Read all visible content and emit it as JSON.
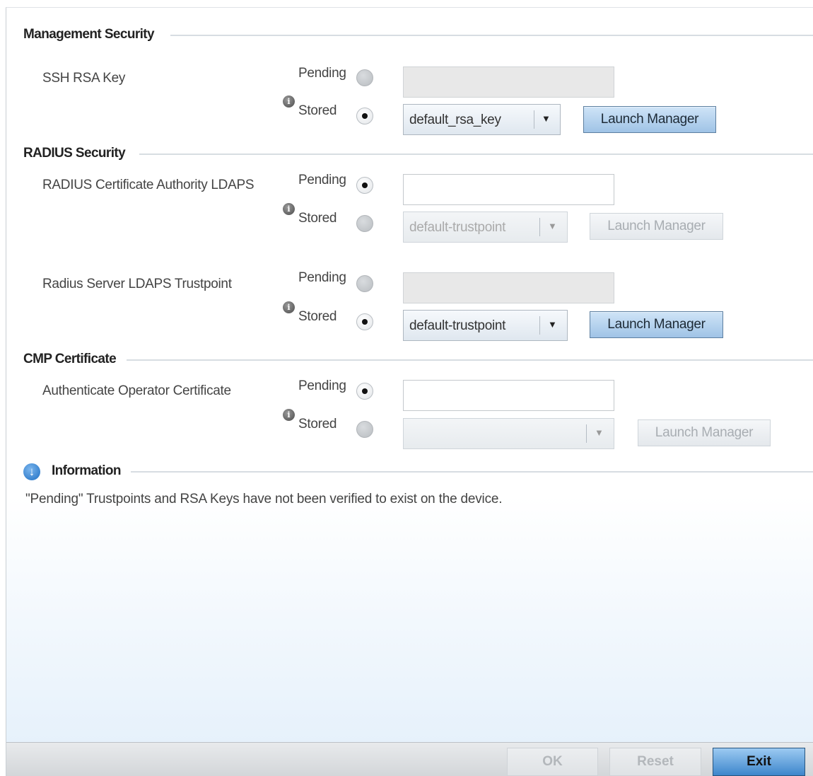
{
  "sections": {
    "management": {
      "title": "Management Security",
      "ssh_rsa_key": {
        "label": "SSH RSA Key",
        "pending_label": "Pending",
        "stored_label": "Stored",
        "selected": "stored",
        "pending_value": "",
        "stored_value": "default_rsa_key",
        "launch_label": "Launch Manager"
      }
    },
    "radius": {
      "title": "RADIUS Security",
      "ca_ldaps": {
        "label": "RADIUS Certificate Authority LDAPS",
        "pending_label": "Pending",
        "stored_label": "Stored",
        "selected": "pending",
        "pending_value": "",
        "stored_value": "default-trustpoint",
        "launch_label": "Launch Manager"
      },
      "server_ldaps": {
        "label": "Radius Server LDAPS Trustpoint",
        "pending_label": "Pending",
        "stored_label": "Stored",
        "selected": "stored",
        "pending_value": "",
        "stored_value": "default-trustpoint",
        "launch_label": "Launch Manager"
      }
    },
    "cmp": {
      "title": "CMP Certificate",
      "operator_cert": {
        "label": "Authenticate Operator Certificate",
        "pending_label": "Pending",
        "stored_label": "Stored",
        "selected": "pending",
        "pending_value": "",
        "stored_value": "",
        "launch_label": "Launch Manager"
      }
    },
    "information": {
      "title": "Information",
      "text": "\"Pending\" Trustpoints and RSA Keys have not been verified to exist on the device."
    }
  },
  "footer": {
    "ok_label": "OK",
    "reset_label": "Reset",
    "exit_label": "Exit"
  },
  "icons": {
    "info_small": "i",
    "info_expand": "↓",
    "dropdown": "▼"
  },
  "colors": {
    "button_blue": "#9fc3e6",
    "exit_blue": "#3d86cc",
    "info_blue": "#1e6ec2"
  }
}
